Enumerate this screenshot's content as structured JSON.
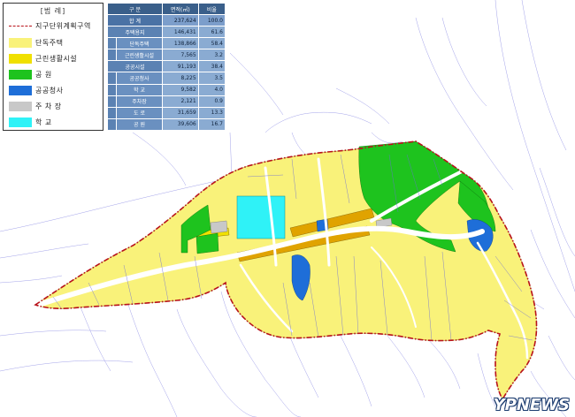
{
  "legend": {
    "title": "[범 례]",
    "items": [
      {
        "label": "지구단위계획구역",
        "kind": "line",
        "color": "#b8121a"
      },
      {
        "label": "단독주택",
        "kind": "fill",
        "color": "#f9f27a"
      },
      {
        "label": "근린생활시설",
        "kind": "fill",
        "color": "#f0e000"
      },
      {
        "label": "공 원",
        "kind": "fill",
        "color": "#1ec31e"
      },
      {
        "label": "공공청사",
        "kind": "fill",
        "color": "#1e6ed8"
      },
      {
        "label": "주 차 장",
        "kind": "fill",
        "color": "#c8c8c8"
      },
      {
        "label": "학 교",
        "kind": "fill",
        "color": "#2ff2f7"
      }
    ]
  },
  "table": {
    "headers": [
      "구 분",
      "면적(㎡)",
      "비율"
    ],
    "rows": [
      {
        "cat": "합 계",
        "sub": "",
        "area": "237,624",
        "ratio": "100.0",
        "total": true
      },
      {
        "cat": "주택용지",
        "sub": "",
        "area": "146,431",
        "ratio": "61.6"
      },
      {
        "cat": "",
        "sub": "단독주택",
        "area": "138,866",
        "ratio": "58.4"
      },
      {
        "cat": "",
        "sub": "근린생활시설",
        "area": "7,565",
        "ratio": "3.2"
      },
      {
        "cat": "공공시설",
        "sub": "",
        "area": "91,193",
        "ratio": "38.4"
      },
      {
        "cat": "",
        "sub": "공공청사",
        "area": "8,225",
        "ratio": "3.5"
      },
      {
        "cat": "",
        "sub": "학 교",
        "area": "9,582",
        "ratio": "4.0"
      },
      {
        "cat": "",
        "sub": "주차장",
        "area": "2,121",
        "ratio": "0.9"
      },
      {
        "cat": "",
        "sub": "도 로",
        "area": "31,659",
        "ratio": "13.3"
      },
      {
        "cat": "",
        "sub": "공 원",
        "area": "39,606",
        "ratio": "16.7"
      }
    ]
  },
  "watermark": "YPNEWS",
  "colors": {
    "residential": "#f9f27a",
    "commercial": "#f0e000",
    "park": "#1ec31e",
    "public_office": "#1e6ed8",
    "parking": "#c8c8c8",
    "school": "#2ff2f7",
    "boundary": "#b8121a",
    "road_lines": "#6b6bd8"
  }
}
